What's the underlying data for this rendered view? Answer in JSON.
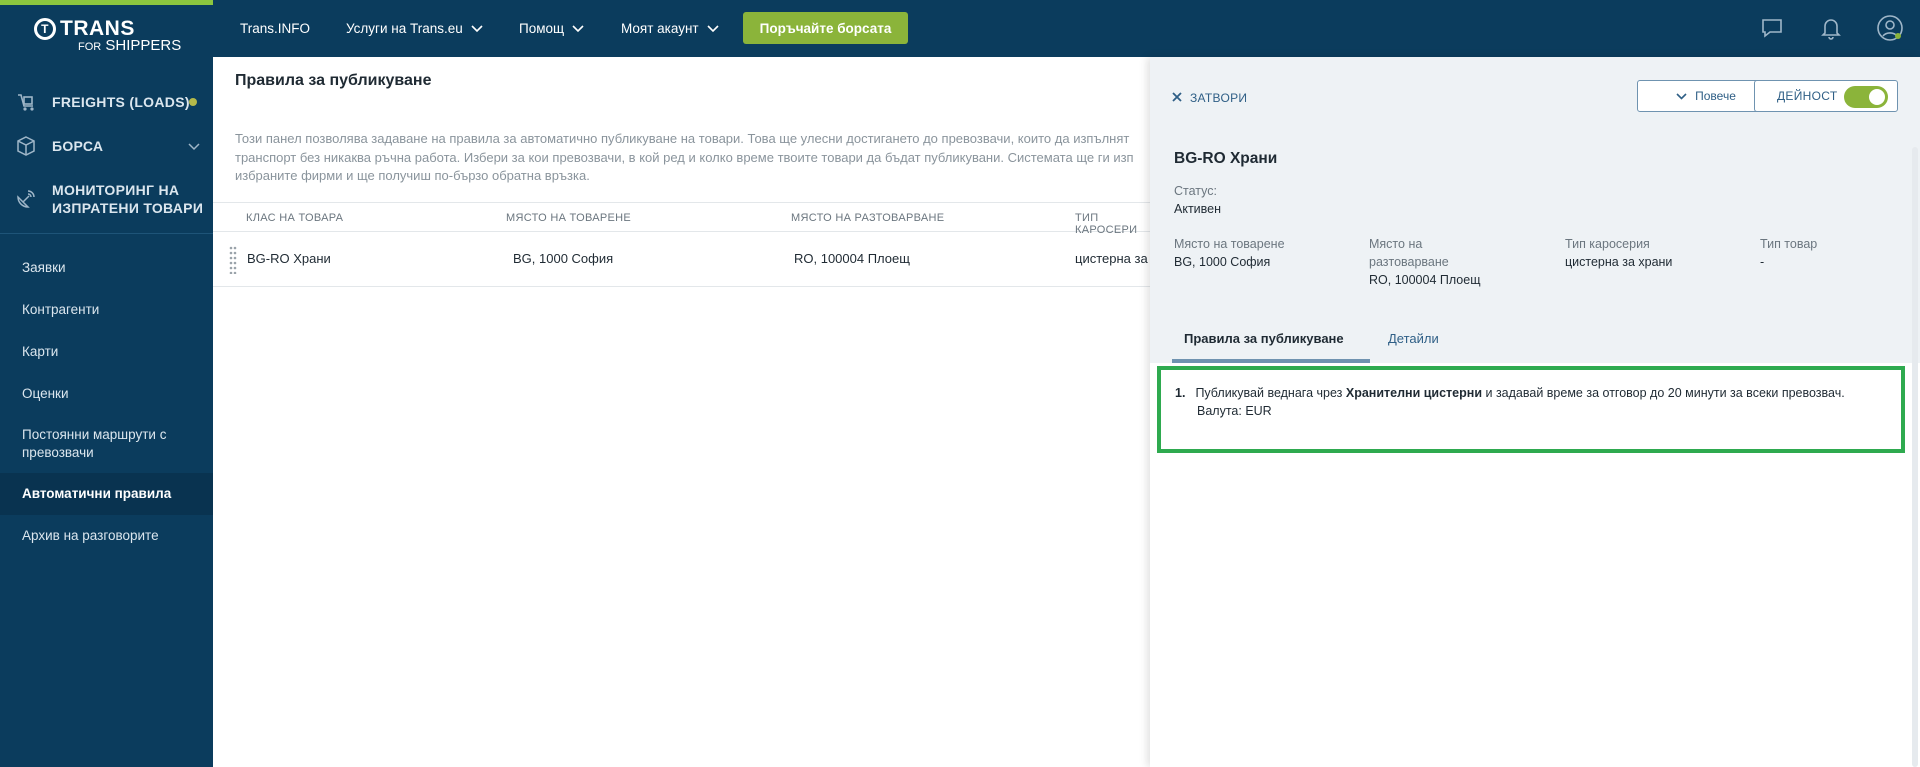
{
  "colors": {
    "brand": "#0b3c5d",
    "accent": "#8bb43a",
    "highlight": "#2eaa4f"
  },
  "logo": {
    "top": "T TRANS",
    "for": "FOR",
    "shippers": "SHIPPERS"
  },
  "sidebar": {
    "main": [
      {
        "label": "FREIGHTS (LOADS)",
        "icon": "freight-icon"
      },
      {
        "label": "БОРСА",
        "icon": "box-icon"
      },
      {
        "label_1": "МОНИТОРИНГ НА",
        "label_2": "ИЗПРАТЕНИ ТОВАРИ",
        "icon": "satellite-icon"
      }
    ],
    "sub": [
      "Заявки",
      "Контрагенти",
      "Карти",
      "Оценки",
      "Постоянни маршрути с превозвачи",
      "Автоматични правила",
      "Архив на разговорите"
    ]
  },
  "header": {
    "nav": [
      "Trans.INFO",
      "Услуги на Trans.eu",
      "Помощ",
      "Моят акаунт"
    ],
    "cta": "Поръчайте борсата"
  },
  "content": {
    "title": "Правила за публикуване",
    "desc_1": "Този панел позволява задаване на правила за автоматично публикуване на товари. Това ще улесни достигането до превозвачи, които да изпълнят",
    "desc_2": "транспорт без никаква ръчна работа. Избери за кои превозвачи, в кой ред и колко време твоите товари да бъдат публикувани. Системата ще ги изп",
    "desc_3": "избраните фирми и ще получиш по-бързо обратна връзка.",
    "columns": [
      "КЛАС НА ТОВАРА",
      "МЯСТО НА ТОВАРЕНЕ",
      "МЯСТО НА РАЗТОВАРВАНЕ",
      "ТИП КАРОСЕРИ"
    ],
    "rows": [
      {
        "class": "BG-RO Храни",
        "load": "BG, 1000 София",
        "unload": "RO, 100004 Плоещ",
        "body": "цистерна за"
      }
    ]
  },
  "panel": {
    "close": "ЗАТВОРИ",
    "more": "Повече",
    "activity": "ДЕЙНОСТ",
    "title": "BG-RO Храни",
    "status_label": "Статус:",
    "status_value": "Активен",
    "load_label": "Място на товарене",
    "load_value": "BG, 1000 София",
    "unload_label_1": "Място на",
    "unload_label_2": "разтоварване",
    "unload_value": "RO, 100004 Плоещ",
    "body_label": "Тип каросерия",
    "body_value": "цистерна за храни",
    "goods_label": "Тип товар",
    "goods_value": "-",
    "tabs": [
      "Правила за публикуване",
      "Детайли"
    ],
    "rule": {
      "num": "1.",
      "pre": "Публикувай веднага чрез",
      "bold": "Хранителни цистерни",
      "post": "и задавай време за отговор до 20 минути за всеки превозвач.",
      "currency": "Валута: EUR"
    }
  }
}
